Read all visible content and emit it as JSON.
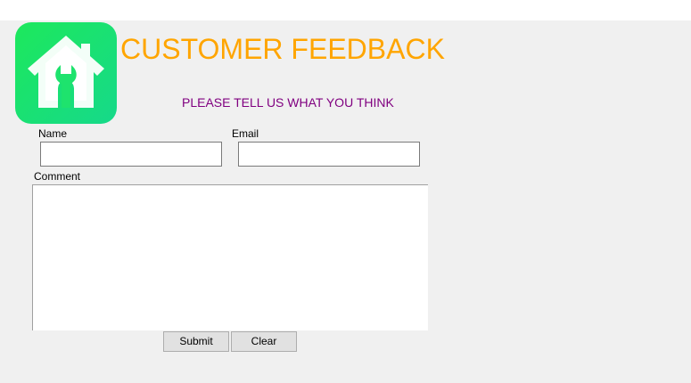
{
  "header": {
    "title": "CUSTOMER FEEDBACK",
    "subtitle": "PLEASE TELL US WHAT YOU THINK",
    "logo_icon": "home-repair-icon"
  },
  "form": {
    "name_label": "Name",
    "name_value": "",
    "email_label": "Email",
    "email_value": "",
    "comment_label": "Comment",
    "comment_value": ""
  },
  "buttons": {
    "submit_label": "Submit",
    "clear_label": "Clear"
  },
  "colors": {
    "title": "#ffa500",
    "subtitle": "#800080",
    "background": "#f0f0f0",
    "logo_green": "#1de85c"
  }
}
